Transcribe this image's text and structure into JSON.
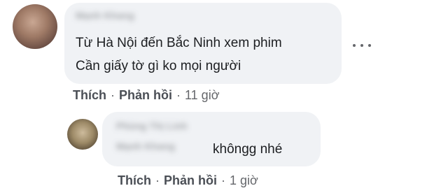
{
  "comment": {
    "author": "Mạnh Khang",
    "lines": [
      "Từ Hà Nội đến Bắc Ninh xem phim",
      "Cần giấy tờ gì ko mọi người"
    ],
    "actions": {
      "like": "Thích",
      "reply": "Phản hồi",
      "time": "11 giờ"
    }
  },
  "reply": {
    "author": "Phùng Thị Linh",
    "mention": "Mạnh Khang",
    "text": "khôngg nhé",
    "actions": {
      "like": "Thích",
      "reply": "Phản hồi",
      "time": "1 giờ"
    }
  },
  "separator": "·",
  "colors": {
    "bubble": "#f0f2f5",
    "text": "#1c1e21",
    "meta": "#65676b"
  }
}
